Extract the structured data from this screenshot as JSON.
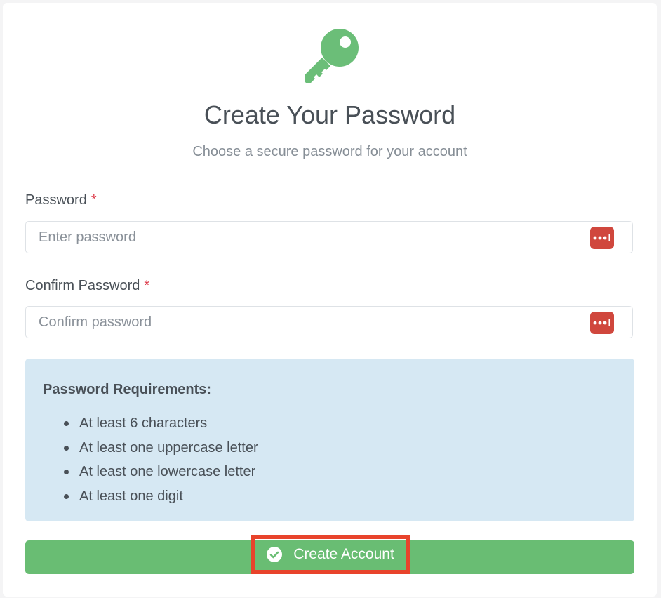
{
  "header": {
    "icon": "key-icon",
    "title": "Create Your Password",
    "subtitle": "Choose a secure password for your account"
  },
  "form": {
    "password": {
      "label": "Password",
      "required_mark": "*",
      "placeholder": "Enter password",
      "value": ""
    },
    "confirm_password": {
      "label": "Confirm Password",
      "required_mark": "*",
      "placeholder": "Confirm password",
      "value": ""
    },
    "password_manager_icon": "password-manager-icon"
  },
  "requirements": {
    "title": "Password Requirements:",
    "items": [
      "At least 6 characters",
      "At least one uppercase letter",
      "At least one lowercase letter",
      "At least one digit"
    ]
  },
  "submit": {
    "label": "Create Account",
    "icon": "check-circle-icon"
  },
  "colors": {
    "accent_green": "#69bd73",
    "icon_green": "#6bbe78",
    "required_red": "#dc3545",
    "password_manager_red": "#d0473d",
    "requirements_background": "#d6e8f3",
    "highlight_red": "#e8432b"
  }
}
